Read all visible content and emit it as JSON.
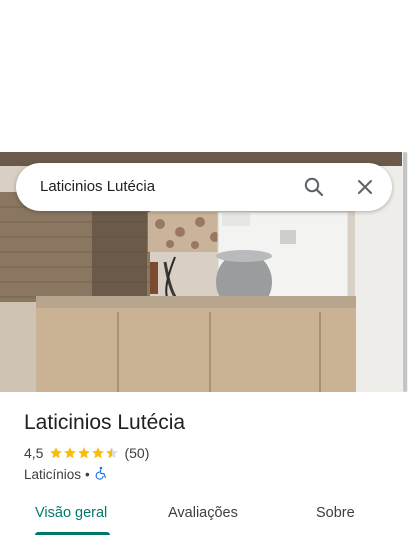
{
  "search": {
    "query": "Laticinios Lutécia"
  },
  "place": {
    "name": "Laticinios Lutécia",
    "rating": "4,5",
    "stars": 4.5,
    "reviews": "(50)",
    "category": "Laticínios",
    "separator": "•"
  },
  "tabs": [
    {
      "label": "Visão geral",
      "active": true
    },
    {
      "label": "Avaliações",
      "active": false
    },
    {
      "label": "Sobre",
      "active": false
    }
  ],
  "colors": {
    "accent": "#00796b",
    "star": "#fbbc04",
    "accessibility": "#1a73e8"
  },
  "icons": {
    "search": "search-icon",
    "close": "close-icon",
    "accessibility": "wheelchair-icon"
  }
}
